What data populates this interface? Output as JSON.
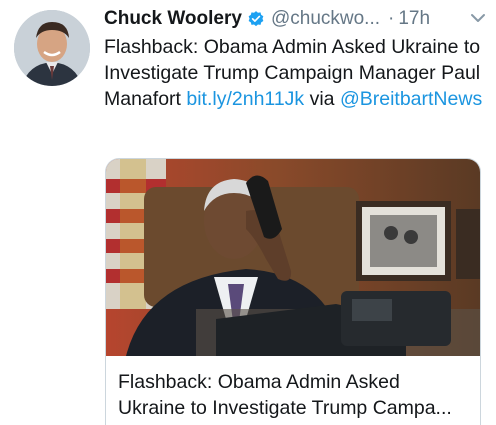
{
  "tweet": {
    "author_name": "Chuck Woolery",
    "handle": "@chuckwo...",
    "separator": "·",
    "time": "17h",
    "text_plain": "Flashback: Obama Admin Asked Ukraine to Investigate Trump Campaign Manager Paul Manafort ",
    "link": "bit.ly/2nh11Jk",
    "text_via": " via ",
    "mention": "@BreitbartNews"
  },
  "card": {
    "title_line1": "Flashback: Obama Admin Asked",
    "title_line2": "Ukraine to Investigate Trump Campa..."
  },
  "icons": {
    "verified": "verified-badge-icon",
    "caret": "chevron-down-icon"
  },
  "colors": {
    "link": "#1b95e0",
    "muted": "#657786",
    "text": "#14171a",
    "border": "#ccd6dd"
  }
}
